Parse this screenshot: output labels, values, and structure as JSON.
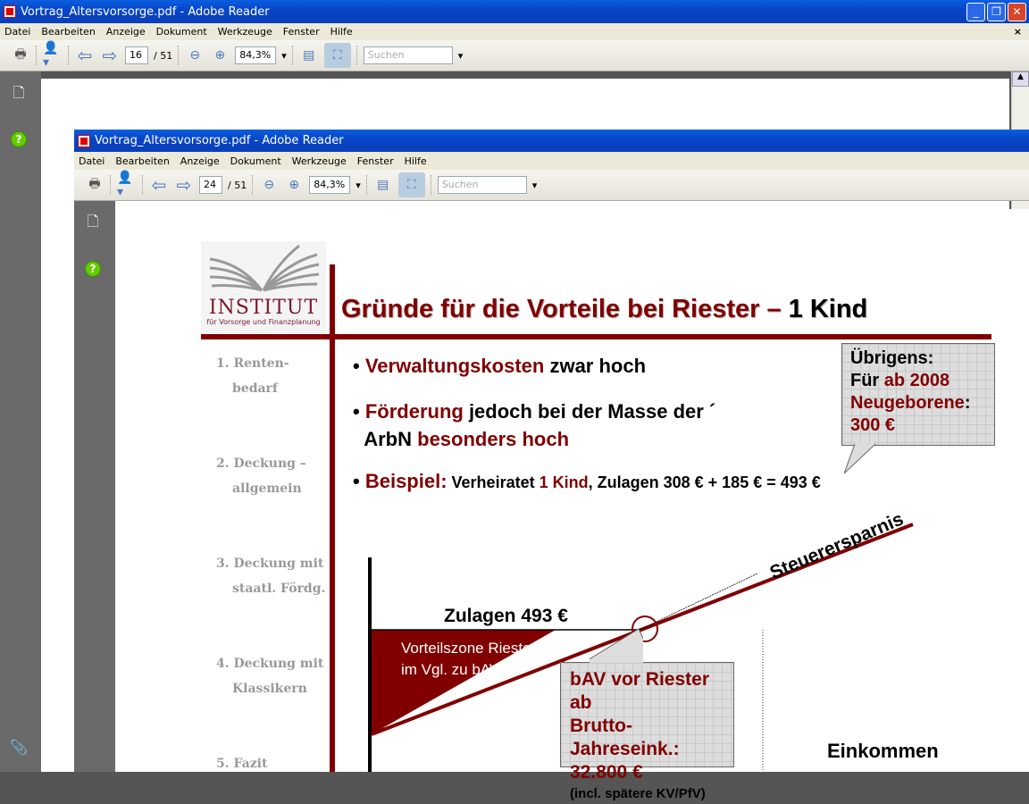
{
  "outer_window": {
    "title": "Vortrag_Altersvorsorge.pdf - Adobe Reader",
    "menu": [
      "Datei",
      "Bearbeiten",
      "Anzeige",
      "Dokument",
      "Werkzeuge",
      "Fenster",
      "Hilfe"
    ],
    "page_current": "16",
    "page_total": "/ 51",
    "zoom": "84,3%",
    "search_placeholder": "Suchen",
    "close_doc": "×"
  },
  "inner_window": {
    "title": "Vortrag_Altersvorsorge.pdf - Adobe Reader",
    "menu": [
      "Datei",
      "Bearbeiten",
      "Anzeige",
      "Dokument",
      "Werkzeuge",
      "Fenster",
      "Hilfe"
    ],
    "page_current": "24",
    "page_total": "/ 51",
    "zoom": "84,3%",
    "search_placeholder": "Suchen"
  },
  "slide": {
    "logo": {
      "name": "INSTITUT",
      "subtitle": "für Vorsorge und Finanzplanung"
    },
    "title_a": "Gründe für die Vorteile bei Riester – ",
    "title_b": "1 Kind",
    "nav": [
      {
        "l1": "1. Renten-",
        "l2": "bedarf"
      },
      {
        "l1": "2. Deckung –",
        "l2": "allgemein"
      },
      {
        "l1": "3. Deckung mit",
        "l2": "staatl. Fördg."
      },
      {
        "l1": "4. Deckung mit",
        "l2": "Klassikern"
      },
      {
        "l1": "5. Fazit",
        "l2": ""
      }
    ],
    "bullets": [
      {
        "a": "Verwaltungskosten",
        "b": " zwar hoch"
      },
      {
        "a": "Förderung",
        "b": " jedoch bei der Masse der ´",
        "c": "ArbN ",
        "d": "besonders hoch"
      },
      {
        "a": "Beispiel:",
        "b": " Verheiratet ",
        "c": "1 Kind",
        "d": ", Zulagen 308 € + 185 € = 493 €"
      }
    ],
    "note": {
      "l1": "Übrigens:",
      "l2a": "Für ",
      "l2b": "ab 2008",
      "l3": "Neugeborene",
      "l3b": ":",
      "l4": "300 €"
    },
    "diagram": {
      "zulagen": "Zulagen 493 €",
      "zone_l1": "Vorteilszone Riester",
      "zone_l2": "im Vgl. zu bAV",
      "steuer": "Steuerersparnis",
      "box_l1": "bAV vor Riester ab",
      "box_l2": "Brutto-Jahreseink.:",
      "box_l3": "32.800 €",
      "box_l4": "(incl. spätere KV/PfV)",
      "x_label": "Einkommen"
    }
  }
}
